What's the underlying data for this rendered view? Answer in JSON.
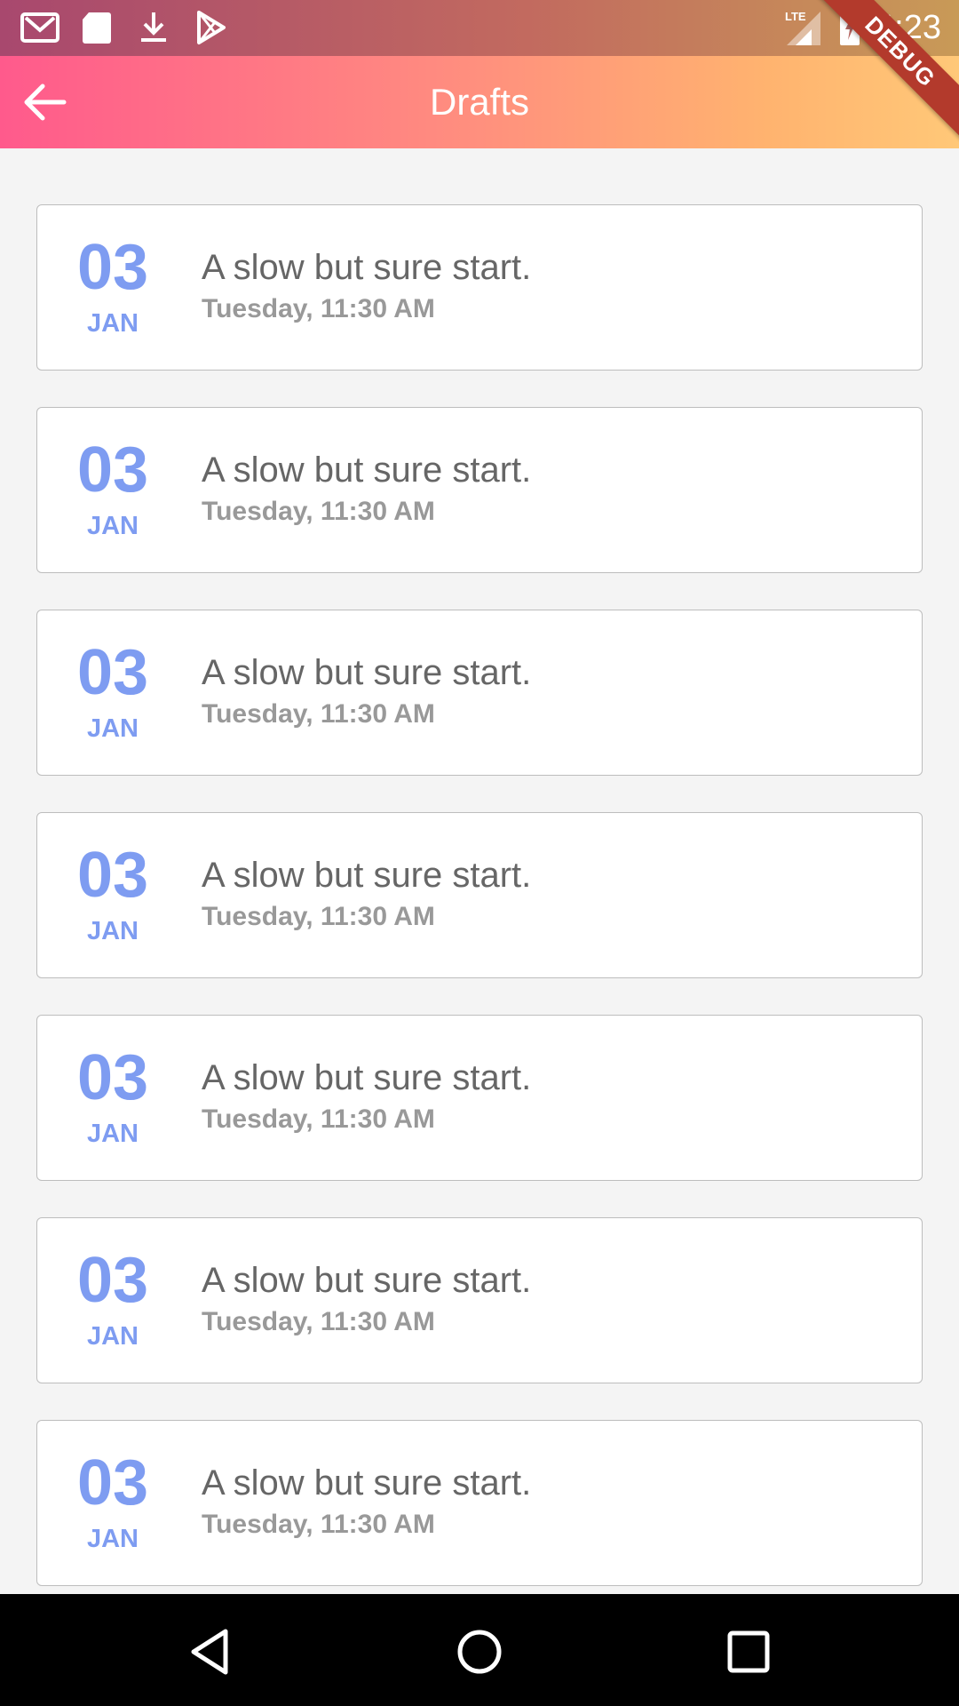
{
  "status_bar": {
    "time": "4:23",
    "network": "LTE",
    "left_icons": [
      "gmail-icon",
      "sd-card-icon",
      "download-icon",
      "play-store-icon"
    ]
  },
  "app_bar": {
    "title": "Drafts",
    "back_icon": "arrow-back-icon",
    "debug_label": "DEBUG"
  },
  "drafts": [
    {
      "day": "03",
      "month": "JAN",
      "title": "A slow but sure start.",
      "subtitle": "Tuesday, 11:30 AM"
    },
    {
      "day": "03",
      "month": "JAN",
      "title": "A slow but sure start.",
      "subtitle": "Tuesday, 11:30 AM"
    },
    {
      "day": "03",
      "month": "JAN",
      "title": "A slow but sure start.",
      "subtitle": "Tuesday, 11:30 AM"
    },
    {
      "day": "03",
      "month": "JAN",
      "title": "A slow but sure start.",
      "subtitle": "Tuesday, 11:30 AM"
    },
    {
      "day": "03",
      "month": "JAN",
      "title": "A slow but sure start.",
      "subtitle": "Tuesday, 11:30 AM"
    },
    {
      "day": "03",
      "month": "JAN",
      "title": "A slow but sure start.",
      "subtitle": "Tuesday, 11:30 AM"
    },
    {
      "day": "03",
      "month": "JAN",
      "title": "A slow but sure start.",
      "subtitle": "Tuesday, 11:30 AM"
    }
  ],
  "nav_bar": {
    "buttons": [
      "back-triangle-icon",
      "home-circle-icon",
      "recents-square-icon"
    ]
  },
  "colors": {
    "accent_date": "#7e9cf1",
    "app_bar_start": "#ff5a8c",
    "app_bar_end": "#ffc878",
    "debug_banner": "#b33a2c"
  }
}
